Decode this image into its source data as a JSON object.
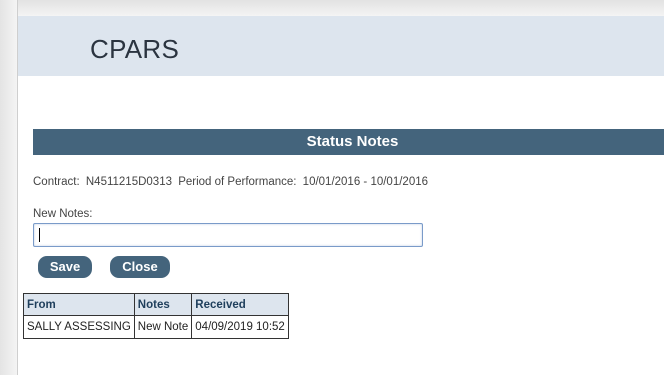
{
  "app": {
    "title": "CPARS"
  },
  "section": {
    "title": "Status Notes"
  },
  "contract": {
    "label": "Contract:",
    "number": "N4511215D0313",
    "period_label": "Period of Performance:",
    "period": "10/01/2016 - 10/01/2016"
  },
  "notes_form": {
    "label": "New Notes:",
    "value": "",
    "save_label": "Save",
    "close_label": "Close"
  },
  "notes_table": {
    "columns": [
      "From",
      "Notes",
      "Received"
    ],
    "rows": [
      [
        "SALLY ASSESSING",
        "New Note",
        "04/09/2019 10:52"
      ]
    ]
  },
  "colors": {
    "header_bg": "#dde5ee",
    "accent": "#44647c",
    "table_header_text": "#1f3f5c"
  }
}
